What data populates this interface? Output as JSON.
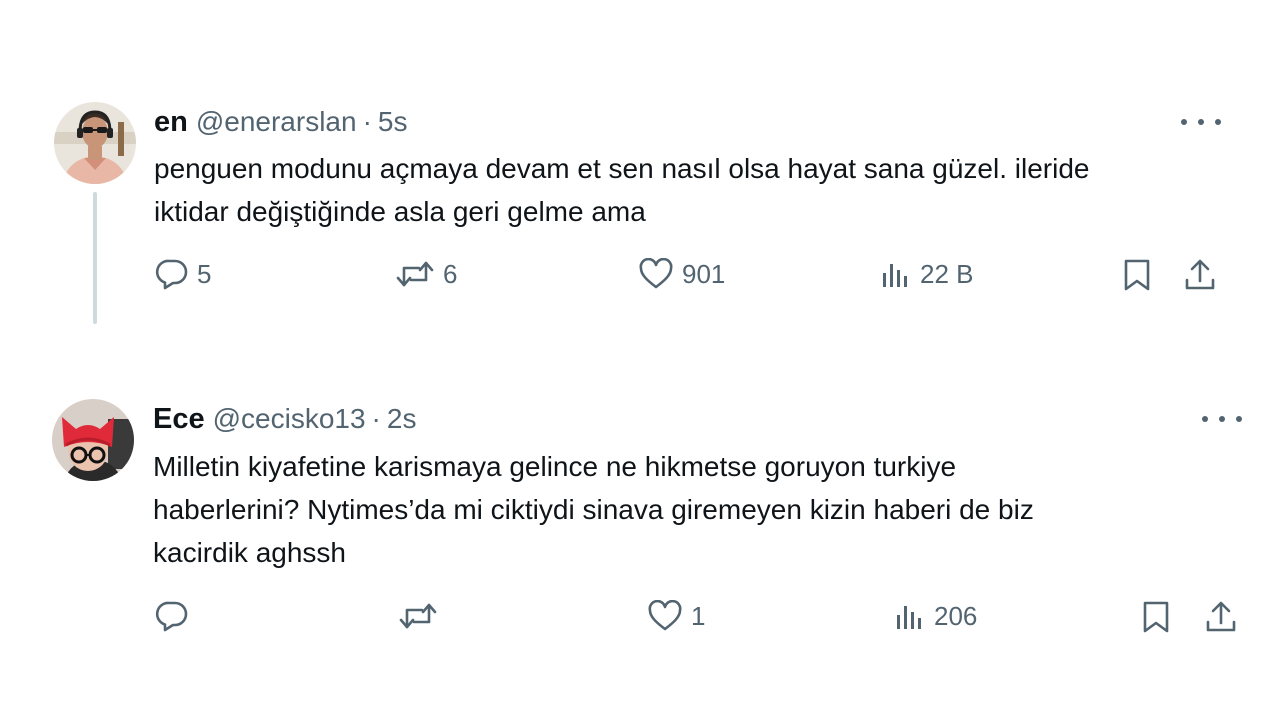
{
  "tweets": [
    {
      "name": "en",
      "handle": "@enerarslan",
      "separator": "·",
      "time": "5s",
      "lines": [
        "penguen modunu açmaya devam et sen nasıl olsa hayat sana güzel. ileride",
        "iktidar değiştiğinde asla geri gelme ama"
      ],
      "replies": "5",
      "retweets": "6",
      "likes": "901",
      "views": "22 B",
      "has_thread_line": true
    },
    {
      "name": "Ece",
      "handle": "@cecisko13",
      "separator": "·",
      "time": "2s",
      "lines": [
        "Milletin kiyafetine karismaya gelince ne hikmetse goruyon turkiye",
        "haberlerini? Nytimes’da mi ciktiydi sinava giremeyen kizin haberi de biz",
        "kacirdik aghssh"
      ],
      "replies": "",
      "retweets": "",
      "likes": "1",
      "views": "206",
      "has_thread_line": false
    }
  ],
  "colors": {
    "text": "#0f1419",
    "secondary": "#536471",
    "thread_line": "#cfd9de",
    "background": "#ffffff"
  },
  "icons": [
    "reply-icon",
    "retweet-icon",
    "like-icon",
    "views-icon",
    "bookmark-icon",
    "share-icon",
    "more-icon"
  ]
}
